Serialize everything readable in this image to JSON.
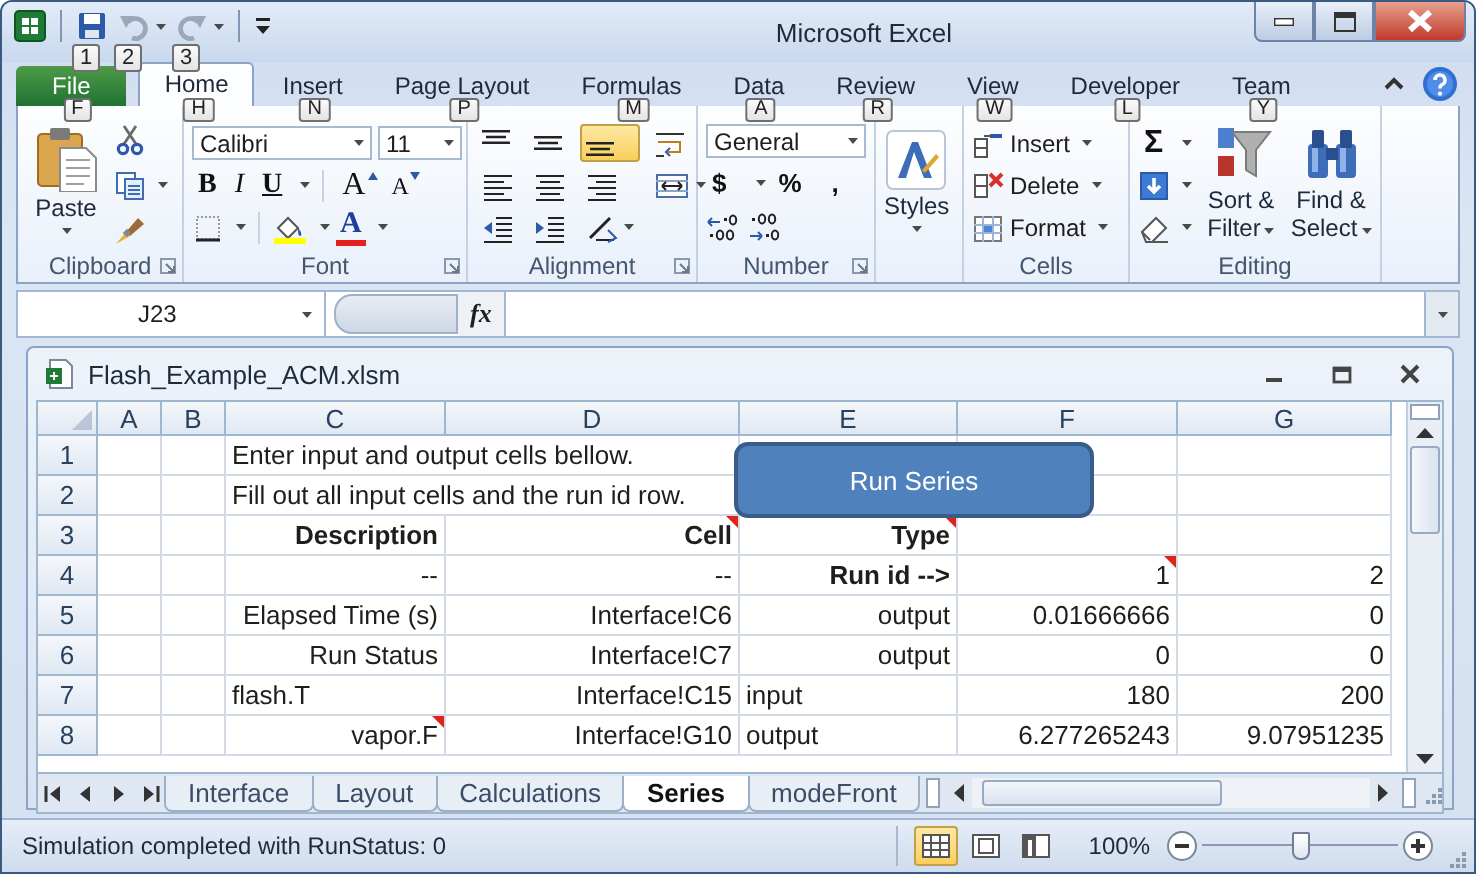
{
  "window": {
    "title": "Microsoft Excel"
  },
  "quick_access": [
    {
      "kind": "save",
      "keytip": "1",
      "disabled": false
    },
    {
      "kind": "undo",
      "keytip": "2",
      "disabled": true
    },
    {
      "kind": "redo",
      "keytip": "3",
      "disabled": true
    }
  ],
  "tabs": [
    {
      "label": "File",
      "keytip": "F",
      "kind": "file",
      "selected": false
    },
    {
      "label": "Home",
      "keytip": "H",
      "kind": "tab",
      "selected": true
    },
    {
      "label": "Insert",
      "keytip": "N",
      "kind": "tab",
      "selected": false
    },
    {
      "label": "Page Layout",
      "keytip": "P",
      "kind": "tab",
      "selected": false
    },
    {
      "label": "Formulas",
      "keytip": "M",
      "kind": "tab",
      "selected": false
    },
    {
      "label": "Data",
      "keytip": "A",
      "kind": "tab",
      "selected": false
    },
    {
      "label": "Review",
      "keytip": "R",
      "kind": "tab",
      "selected": false
    },
    {
      "label": "View",
      "keytip": "W",
      "kind": "tab",
      "selected": false
    },
    {
      "label": "Developer",
      "keytip": "L",
      "kind": "tab",
      "selected": false
    },
    {
      "label": "Team",
      "keytip": "Y",
      "kind": "tab",
      "selected": false
    }
  ],
  "ribbon": {
    "clipboard": {
      "label": "Clipboard",
      "paste": "Paste"
    },
    "font": {
      "label": "Font",
      "font_name": "Calibri",
      "font_size": "11",
      "bold": "B",
      "italic": "I",
      "underline": "U",
      "grow": "A",
      "shrink": "A",
      "font_color": "A"
    },
    "alignment": {
      "label": "Alignment",
      "buttons": [
        {
          "kind": "top",
          "selected": false
        },
        {
          "kind": "middle",
          "selected": false
        },
        {
          "kind": "bottom",
          "selected": true
        },
        {
          "kind": "wrap",
          "selected": false
        },
        {
          "kind": "left",
          "selected": false
        },
        {
          "kind": "center",
          "selected": false
        },
        {
          "kind": "right",
          "selected": false
        },
        {
          "kind": "merge",
          "selected": false
        },
        {
          "kind": "outdent",
          "selected": false
        },
        {
          "kind": "indent",
          "selected": false
        },
        {
          "kind": "orientation",
          "selected": false
        }
      ]
    },
    "number": {
      "label": "Number",
      "format": "General",
      "currency": "$",
      "percent": "%",
      "comma": ","
    },
    "styles": {
      "button": "Styles"
    },
    "cells": {
      "label": "Cells",
      "insert": "Insert",
      "delete": "Delete",
      "format": "Format"
    },
    "editing": {
      "label": "Editing",
      "sum": "Σ",
      "sort_filter": "Sort & Filter",
      "find_select": "Find & Select"
    }
  },
  "formula_bar": {
    "name_box": "J23",
    "function_label": "fx"
  },
  "workbook": {
    "title": "Flash_Example_ACM.xlsm",
    "columns": [
      "A",
      "B",
      "C",
      "D",
      "E",
      "F",
      "G"
    ],
    "rows": [
      {
        "header": "1",
        "cells": [
          null,
          null,
          {
            "text": "Enter input and output cells bellow.",
            "right_aligned": false,
            "overflow": true
          },
          null,
          null,
          null,
          null
        ]
      },
      {
        "header": "2",
        "cells": [
          null,
          null,
          {
            "text": "Fill out all input cells and the run id row.",
            "right_aligned": false,
            "overflow": true
          },
          null,
          null,
          null,
          null
        ]
      },
      {
        "header": "3",
        "cells": [
          null,
          null,
          {
            "text": "Description",
            "right_aligned": true,
            "bold": true
          },
          {
            "text": "Cell",
            "right_aligned": true,
            "bold": true,
            "comment": true
          },
          {
            "text": "Type",
            "right_aligned": true,
            "bold": true,
            "comment": true
          },
          null,
          null
        ]
      },
      {
        "header": "4",
        "cells": [
          null,
          null,
          {
            "text": "--",
            "right_aligned": true
          },
          {
            "text": "--",
            "right_aligned": true
          },
          {
            "text": "Run id -->",
            "right_aligned": true,
            "bold": true
          },
          {
            "text": "1",
            "right_aligned": true,
            "comment": true
          },
          {
            "text": "2",
            "right_aligned": true
          }
        ]
      },
      {
        "header": "5",
        "cells": [
          null,
          null,
          {
            "text": "Elapsed Time (s)",
            "right_aligned": true
          },
          {
            "text": "Interface!C6",
            "right_aligned": true
          },
          {
            "text": "output",
            "right_aligned": true
          },
          {
            "text": "0.01666666",
            "right_aligned": true
          },
          {
            "text": "0",
            "right_aligned": true
          }
        ]
      },
      {
        "header": "6",
        "cells": [
          null,
          null,
          {
            "text": "Run Status",
            "right_aligned": true
          },
          {
            "text": "Interface!C7",
            "right_aligned": true
          },
          {
            "text": "output",
            "right_aligned": true
          },
          {
            "text": "0",
            "right_aligned": true
          },
          {
            "text": "0",
            "right_aligned": true
          }
        ]
      },
      {
        "header": "7",
        "cells": [
          null,
          null,
          {
            "text": "flash.T",
            "right_aligned": false
          },
          {
            "text": "Interface!C15",
            "right_aligned": true
          },
          {
            "text": "input",
            "right_aligned": false
          },
          {
            "text": "180",
            "right_aligned": true
          },
          {
            "text": "200",
            "right_aligned": true
          }
        ]
      },
      {
        "header": "8",
        "cells": [
          null,
          null,
          {
            "text": "vapor.F",
            "right_aligned": true,
            "comment": true
          },
          {
            "text": "Interface!G10",
            "right_aligned": true
          },
          {
            "text": "output",
            "right_aligned": false
          },
          {
            "text": "6.277265243",
            "right_aligned": true
          },
          {
            "text": "9.07951235",
            "right_aligned": true
          }
        ]
      }
    ],
    "sheet_button": {
      "label": "Run Series"
    },
    "sheet_tabs": [
      {
        "label": "Interface",
        "selected": false
      },
      {
        "label": "Layout",
        "selected": false
      },
      {
        "label": "Calculations",
        "selected": false
      },
      {
        "label": "Series",
        "selected": true
      },
      {
        "label": "modeFront",
        "selected": false
      }
    ]
  },
  "status_bar": {
    "message": "Simulation completed with RunStatus: 0",
    "views": [
      {
        "kind": "normal",
        "selected": true
      },
      {
        "kind": "page_layout",
        "selected": false
      },
      {
        "kind": "page_break",
        "selected": false
      }
    ],
    "zoom": "100%",
    "zoom_slider": {
      "level": 0.5
    }
  }
}
